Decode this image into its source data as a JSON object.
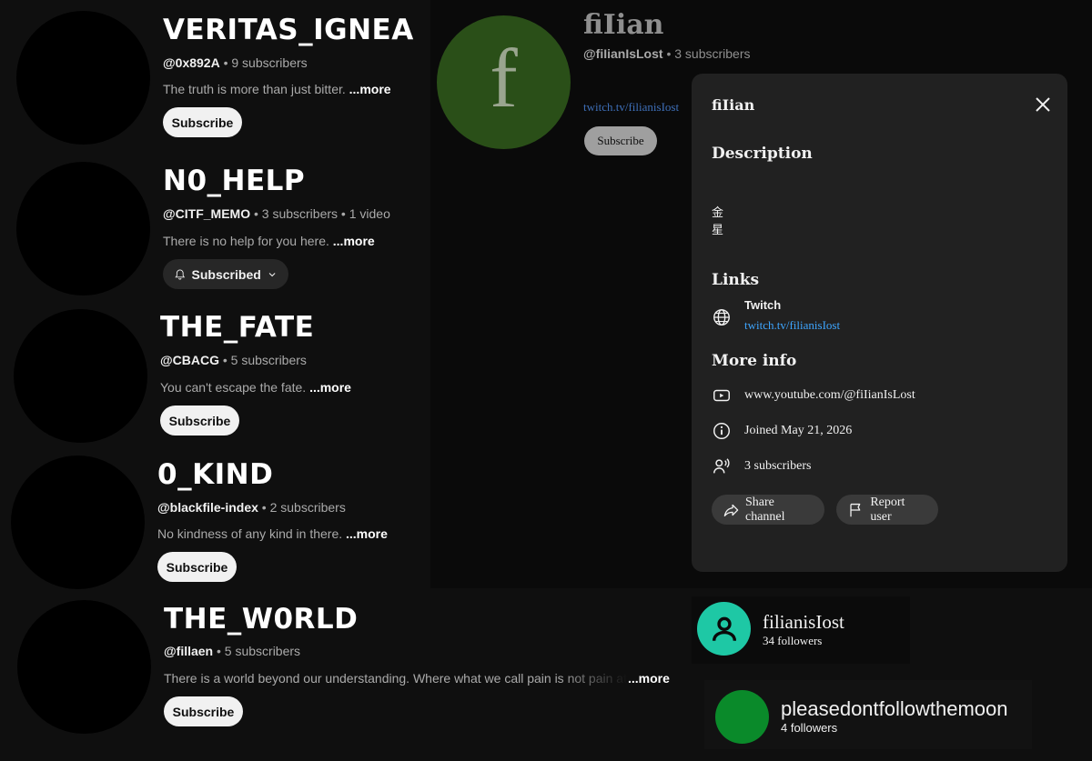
{
  "channels": [
    {
      "title": "VERITAS_IGNEA",
      "handle": "@0x892A",
      "stats": "• 9 subscribers",
      "desc": "The truth is more than just bitter.",
      "more": "...more",
      "button": "Subscribe"
    },
    {
      "title": "N0_HELP",
      "handle": "@CITF_MEMO",
      "stats": "• 3 subscribers • 1 video",
      "desc": "There is no help for you here.",
      "more": "...more",
      "button": "Subscribed"
    },
    {
      "title": "THE_FATE",
      "handle": "@CBACG",
      "stats": "• 5 subscribers",
      "desc": "You can't escape the fate.",
      "more": "...more",
      "button": "Subscribe"
    },
    {
      "title": "0_KIND",
      "handle": "@blackfile-index",
      "stats": "• 2 subscribers",
      "desc": "No kindness of any kind in there.",
      "more": "...more",
      "button": "Subscribe"
    },
    {
      "title": "THE_W0RLD",
      "handle": "@fillaen",
      "stats": "• 5 subscribers",
      "desc": "There is a world beyond our understanding. Where what we call pain is not pain at all, where",
      "more": "...more",
      "button": "Subscribe"
    }
  ],
  "featured": {
    "avatar_letter": "f",
    "avatar_color": "#2a4f18",
    "name": "fiIian",
    "handle": "@fiIianIsLost",
    "stats": "• 3 subscribers",
    "link": "twitch.tv/filianisIost",
    "button": "Subscribe"
  },
  "about": {
    "title": "fiIian",
    "description_heading": "Description",
    "description_lines": [
      "金",
      "星"
    ],
    "links_heading": "Links",
    "link_name": "Twitch",
    "link_url": "twitch.tv/filianisIost",
    "more_info_heading": "More info",
    "url": "www.youtube.com/@fiIianIsLost",
    "joined": "Joined May 21, 2026",
    "subscribers": "3 subscribers",
    "share_label": "Share channel",
    "report_label": "Report user",
    "close_icon": "close-icon"
  },
  "followers": [
    {
      "name": "filianisIost",
      "count": "34 followers",
      "avatar_color": "#1ec8a5"
    },
    {
      "name": "pleasedontfollowthemoon",
      "count": "4 followers",
      "avatar_color": "#0a8a2a"
    }
  ]
}
